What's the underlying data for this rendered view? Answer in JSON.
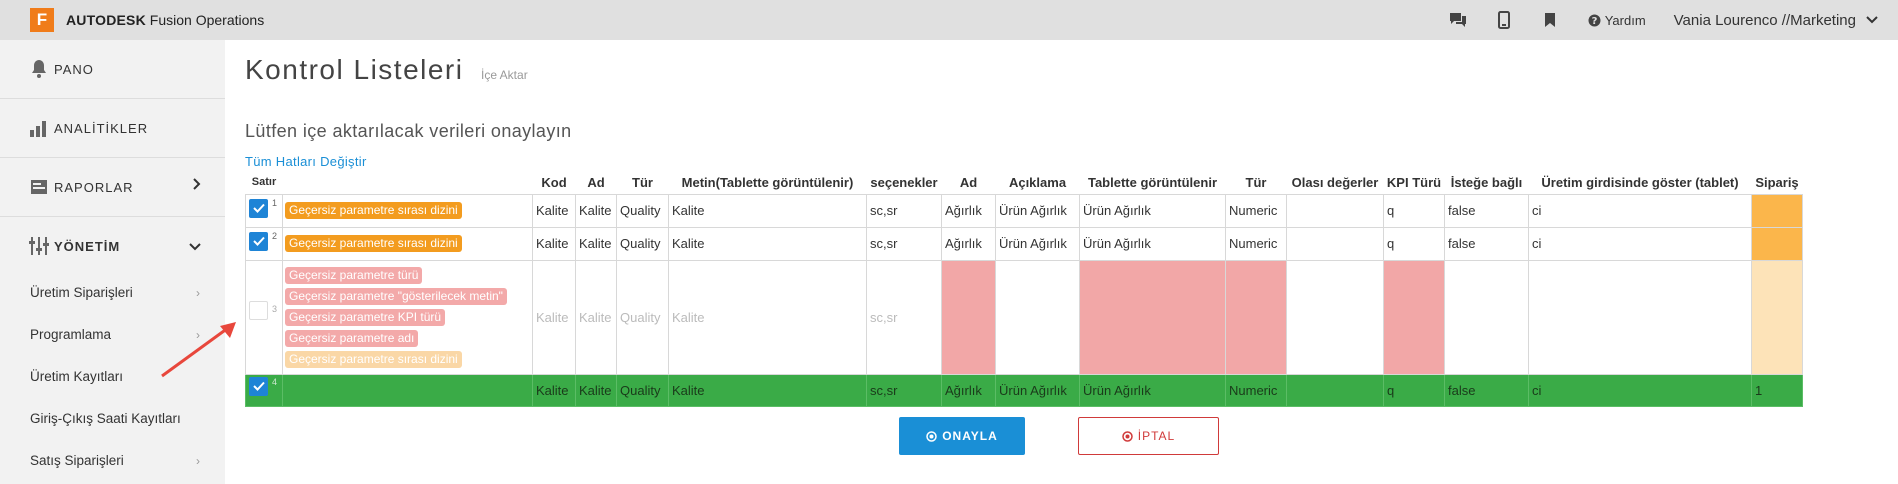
{
  "app": {
    "logo_letter": "F",
    "brand": "AUTODESK",
    "product": "Fusion Operations",
    "accent": "#f07c1a"
  },
  "topbar": {
    "icons": [
      "chat-icon",
      "mobile-icon",
      "bookmark-icon"
    ],
    "help_label": "Yardım",
    "user_label": "Vania Lourenco //Marketing"
  },
  "sidebar": {
    "main_items": [
      {
        "label": "PANO",
        "icon": "bell-icon"
      },
      {
        "label": "ANALİTİKLER",
        "icon": "bar-chart-icon"
      },
      {
        "label": "RAPORLAR",
        "icon": "report-icon"
      },
      {
        "label": "YÖNETİM",
        "icon": "management-icon"
      }
    ],
    "sub_items": [
      {
        "label": "Üretim Siparişleri"
      },
      {
        "label": "Programlama"
      },
      {
        "label": "Üretim Kayıtları"
      },
      {
        "label": "Giriş-Çıkış Saati Kayıtları"
      },
      {
        "label": "Satış Siparişleri"
      }
    ]
  },
  "main": {
    "title": "Kontrol Listeleri",
    "title_sub": "İçe Aktar",
    "subtitle": "Lütfen içe aktarılacak verileri onaylayın",
    "change_all_link": "Tüm Hatları Değiştir"
  },
  "table": {
    "headers": [
      "Satır",
      "",
      "Kod",
      "Ad",
      "Tür",
      "Metin(Tablette görüntülenir)",
      "seçenekler",
      "Ad",
      "Açıklama",
      "Tablette görüntülenir",
      "Tür",
      "Olası değerler",
      "KPI Türü",
      "İsteğe bağlı",
      "Üretim girdisinde göster (tablet)",
      "Sipariş"
    ],
    "rows": [
      {
        "num": "1",
        "checked": true,
        "errors": [
          "Geçersiz parametre sırası dizini"
        ],
        "cells": [
          "Kalite",
          "Kalite",
          "Quality",
          "Kalite",
          "sc,sr",
          "Ağırlık",
          "Ürün Ağırlık",
          "Ürün Ağırlık",
          "Numeric",
          "",
          "q",
          "false",
          "ci",
          ""
        ]
      },
      {
        "num": "2",
        "checked": true,
        "errors": [
          "Geçersiz parametre sırası dizini"
        ],
        "cells": [
          "Kalite",
          "Kalite",
          "Quality",
          "Kalite",
          "sc,sr",
          "Ağırlık",
          "Ürün Ağırlık",
          "Ürün Ağırlık",
          "Numeric",
          "",
          "q",
          "false",
          "ci",
          ""
        ]
      },
      {
        "num": "3",
        "checked": false,
        "errors": [
          "Geçersiz parametre türü",
          "Geçersiz parametre \"gösterilecek metin\"",
          "Geçersiz parametre KPI türü",
          "Geçersiz parametre adı",
          "Geçersiz parametre sırası dizini"
        ],
        "cells": [
          "Kalite",
          "Kalite",
          "Quality",
          "Kalite",
          "sc,sr",
          "",
          "",
          "",
          "",
          "",
          "",
          "",
          "",
          ""
        ]
      },
      {
        "num": "4",
        "checked": true,
        "errors": [],
        "cells": [
          "Kalite",
          "Kalite",
          "Quality",
          "Kalite",
          "sc,sr",
          "Ağırlık",
          "Ürün Ağırlık",
          "Ürün Ağırlık",
          "Numeric",
          "",
          "q",
          "false",
          "ci",
          "1"
        ]
      }
    ]
  },
  "buttons": {
    "confirm": "ONAYLA",
    "cancel": "İPTAL"
  },
  "colors": {
    "confirm_bg": "#1a8fd6",
    "cancel_border": "#d03a3a",
    "error_orange": "#f39c1f",
    "error_pink": "#f3a9a9",
    "row_ok_green": "#3aab47",
    "annotation_arrow": "#e8473c"
  }
}
